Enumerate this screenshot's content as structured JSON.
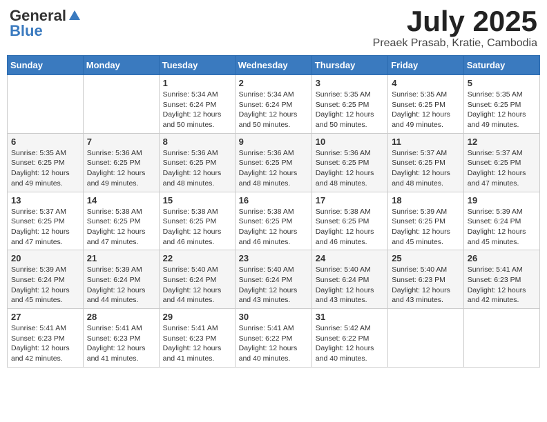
{
  "logo": {
    "general": "General",
    "blue": "Blue"
  },
  "header": {
    "month": "July 2025",
    "location": "Preaek Prasab, Kratie, Cambodia"
  },
  "weekdays": [
    "Sunday",
    "Monday",
    "Tuesday",
    "Wednesday",
    "Thursday",
    "Friday",
    "Saturday"
  ],
  "weeks": [
    [
      {
        "day": "",
        "sunrise": "",
        "sunset": "",
        "daylight": ""
      },
      {
        "day": "",
        "sunrise": "",
        "sunset": "",
        "daylight": ""
      },
      {
        "day": "1",
        "sunrise": "Sunrise: 5:34 AM",
        "sunset": "Sunset: 6:24 PM",
        "daylight": "Daylight: 12 hours and 50 minutes."
      },
      {
        "day": "2",
        "sunrise": "Sunrise: 5:34 AM",
        "sunset": "Sunset: 6:24 PM",
        "daylight": "Daylight: 12 hours and 50 minutes."
      },
      {
        "day": "3",
        "sunrise": "Sunrise: 5:35 AM",
        "sunset": "Sunset: 6:25 PM",
        "daylight": "Daylight: 12 hours and 50 minutes."
      },
      {
        "day": "4",
        "sunrise": "Sunrise: 5:35 AM",
        "sunset": "Sunset: 6:25 PM",
        "daylight": "Daylight: 12 hours and 49 minutes."
      },
      {
        "day": "5",
        "sunrise": "Sunrise: 5:35 AM",
        "sunset": "Sunset: 6:25 PM",
        "daylight": "Daylight: 12 hours and 49 minutes."
      }
    ],
    [
      {
        "day": "6",
        "sunrise": "Sunrise: 5:35 AM",
        "sunset": "Sunset: 6:25 PM",
        "daylight": "Daylight: 12 hours and 49 minutes."
      },
      {
        "day": "7",
        "sunrise": "Sunrise: 5:36 AM",
        "sunset": "Sunset: 6:25 PM",
        "daylight": "Daylight: 12 hours and 49 minutes."
      },
      {
        "day": "8",
        "sunrise": "Sunrise: 5:36 AM",
        "sunset": "Sunset: 6:25 PM",
        "daylight": "Daylight: 12 hours and 48 minutes."
      },
      {
        "day": "9",
        "sunrise": "Sunrise: 5:36 AM",
        "sunset": "Sunset: 6:25 PM",
        "daylight": "Daylight: 12 hours and 48 minutes."
      },
      {
        "day": "10",
        "sunrise": "Sunrise: 5:36 AM",
        "sunset": "Sunset: 6:25 PM",
        "daylight": "Daylight: 12 hours and 48 minutes."
      },
      {
        "day": "11",
        "sunrise": "Sunrise: 5:37 AM",
        "sunset": "Sunset: 6:25 PM",
        "daylight": "Daylight: 12 hours and 48 minutes."
      },
      {
        "day": "12",
        "sunrise": "Sunrise: 5:37 AM",
        "sunset": "Sunset: 6:25 PM",
        "daylight": "Daylight: 12 hours and 47 minutes."
      }
    ],
    [
      {
        "day": "13",
        "sunrise": "Sunrise: 5:37 AM",
        "sunset": "Sunset: 6:25 PM",
        "daylight": "Daylight: 12 hours and 47 minutes."
      },
      {
        "day": "14",
        "sunrise": "Sunrise: 5:38 AM",
        "sunset": "Sunset: 6:25 PM",
        "daylight": "Daylight: 12 hours and 47 minutes."
      },
      {
        "day": "15",
        "sunrise": "Sunrise: 5:38 AM",
        "sunset": "Sunset: 6:25 PM",
        "daylight": "Daylight: 12 hours and 46 minutes."
      },
      {
        "day": "16",
        "sunrise": "Sunrise: 5:38 AM",
        "sunset": "Sunset: 6:25 PM",
        "daylight": "Daylight: 12 hours and 46 minutes."
      },
      {
        "day": "17",
        "sunrise": "Sunrise: 5:38 AM",
        "sunset": "Sunset: 6:25 PM",
        "daylight": "Daylight: 12 hours and 46 minutes."
      },
      {
        "day": "18",
        "sunrise": "Sunrise: 5:39 AM",
        "sunset": "Sunset: 6:25 PM",
        "daylight": "Daylight: 12 hours and 45 minutes."
      },
      {
        "day": "19",
        "sunrise": "Sunrise: 5:39 AM",
        "sunset": "Sunset: 6:24 PM",
        "daylight": "Daylight: 12 hours and 45 minutes."
      }
    ],
    [
      {
        "day": "20",
        "sunrise": "Sunrise: 5:39 AM",
        "sunset": "Sunset: 6:24 PM",
        "daylight": "Daylight: 12 hours and 45 minutes."
      },
      {
        "day": "21",
        "sunrise": "Sunrise: 5:39 AM",
        "sunset": "Sunset: 6:24 PM",
        "daylight": "Daylight: 12 hours and 44 minutes."
      },
      {
        "day": "22",
        "sunrise": "Sunrise: 5:40 AM",
        "sunset": "Sunset: 6:24 PM",
        "daylight": "Daylight: 12 hours and 44 minutes."
      },
      {
        "day": "23",
        "sunrise": "Sunrise: 5:40 AM",
        "sunset": "Sunset: 6:24 PM",
        "daylight": "Daylight: 12 hours and 43 minutes."
      },
      {
        "day": "24",
        "sunrise": "Sunrise: 5:40 AM",
        "sunset": "Sunset: 6:24 PM",
        "daylight": "Daylight: 12 hours and 43 minutes."
      },
      {
        "day": "25",
        "sunrise": "Sunrise: 5:40 AM",
        "sunset": "Sunset: 6:23 PM",
        "daylight": "Daylight: 12 hours and 43 minutes."
      },
      {
        "day": "26",
        "sunrise": "Sunrise: 5:41 AM",
        "sunset": "Sunset: 6:23 PM",
        "daylight": "Daylight: 12 hours and 42 minutes."
      }
    ],
    [
      {
        "day": "27",
        "sunrise": "Sunrise: 5:41 AM",
        "sunset": "Sunset: 6:23 PM",
        "daylight": "Daylight: 12 hours and 42 minutes."
      },
      {
        "day": "28",
        "sunrise": "Sunrise: 5:41 AM",
        "sunset": "Sunset: 6:23 PM",
        "daylight": "Daylight: 12 hours and 41 minutes."
      },
      {
        "day": "29",
        "sunrise": "Sunrise: 5:41 AM",
        "sunset": "Sunset: 6:23 PM",
        "daylight": "Daylight: 12 hours and 41 minutes."
      },
      {
        "day": "30",
        "sunrise": "Sunrise: 5:41 AM",
        "sunset": "Sunset: 6:22 PM",
        "daylight": "Daylight: 12 hours and 40 minutes."
      },
      {
        "day": "31",
        "sunrise": "Sunrise: 5:42 AM",
        "sunset": "Sunset: 6:22 PM",
        "daylight": "Daylight: 12 hours and 40 minutes."
      },
      {
        "day": "",
        "sunrise": "",
        "sunset": "",
        "daylight": ""
      },
      {
        "day": "",
        "sunrise": "",
        "sunset": "",
        "daylight": ""
      }
    ]
  ]
}
